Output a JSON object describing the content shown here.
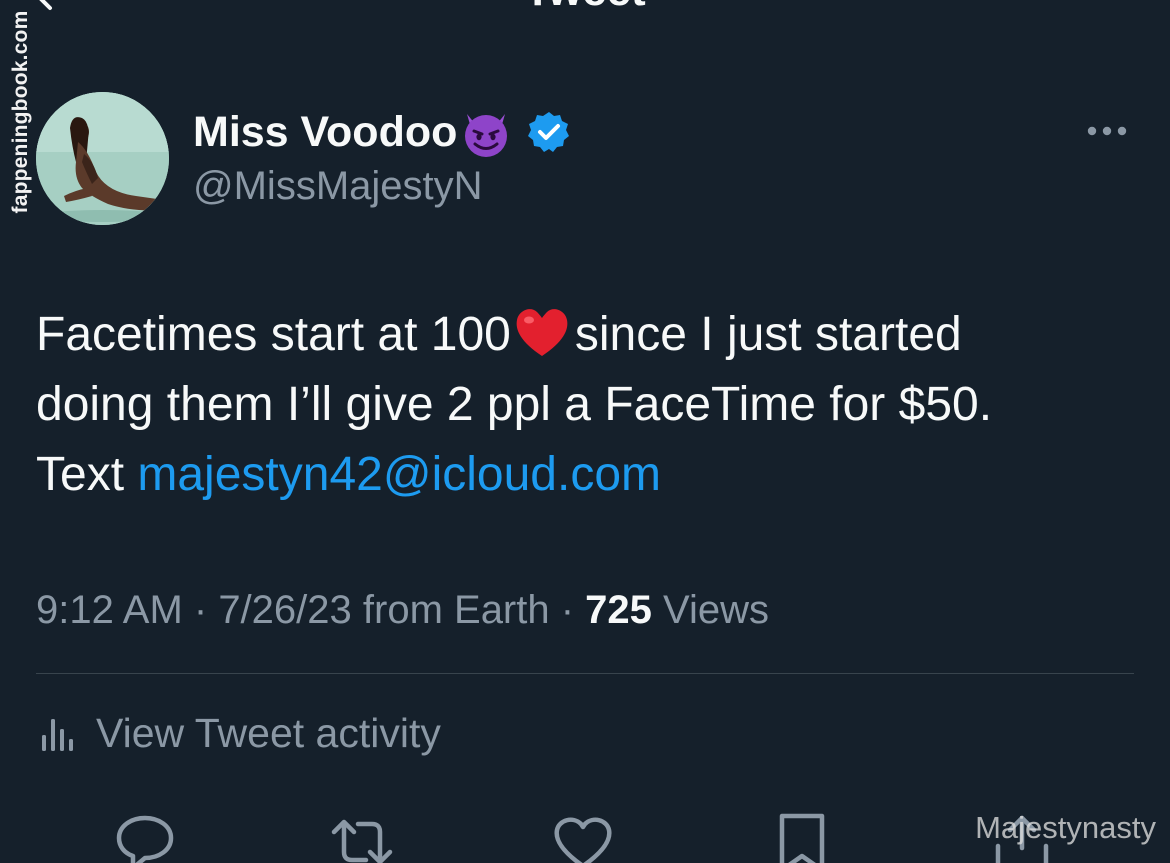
{
  "header": {
    "title": "Tweet",
    "back_icon": "arrow-left-icon"
  },
  "watermarks": {
    "side": "fappeningbook.com",
    "bottom": "Majestynasty"
  },
  "author": {
    "display_name": "Miss Voodoo",
    "name_emoji": "smiling-face-with-horns-icon",
    "verified_icon": "verified-badge-icon",
    "handle": "@MissMajestyN"
  },
  "tweet": {
    "line1_a": "Facetimes start at 100",
    "line1_emoji": "red-heart-icon",
    "line1_b": "since I just started",
    "line2": "doing them I’ll give 2 ppl a FaceTime for $50.",
    "line3_prefix": "Text ",
    "link": "majestyn42@icloud.com"
  },
  "meta": {
    "time": "9:12 AM",
    "sep1": " · ",
    "date": "7/26/23",
    "source": " from Earth",
    "sep2": " · ",
    "views_count": "725",
    "views_label": " Views"
  },
  "activity": {
    "label": "View Tweet activity",
    "icon": "bar-chart-icon"
  },
  "actions": [
    {
      "name": "reply",
      "icon": "reply-icon"
    },
    {
      "name": "retweet",
      "icon": "retweet-icon"
    },
    {
      "name": "like",
      "icon": "heart-icon"
    },
    {
      "name": "bookmark",
      "icon": "bookmark-icon"
    },
    {
      "name": "share",
      "icon": "share-icon"
    }
  ],
  "colors": {
    "background": "#15202b",
    "text": "#f7f9f9",
    "secondary": "#8b98a5",
    "link": "#1d9bf0",
    "divider": "#38444d",
    "verified": "#1d9bf0"
  }
}
